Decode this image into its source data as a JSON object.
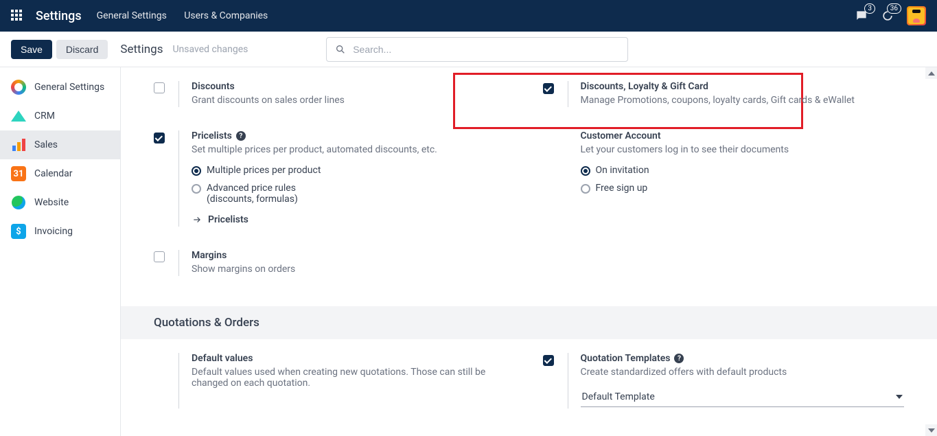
{
  "topnav": {
    "brand": "Settings",
    "menu": [
      "General Settings",
      "Users & Companies"
    ],
    "messages_badge": "3",
    "activities_badge": "36"
  },
  "actionbar": {
    "save": "Save",
    "discard": "Discard",
    "breadcrumb": "Settings",
    "unsaved": "Unsaved changes",
    "search_placeholder": "Search..."
  },
  "sidebar": {
    "items": [
      {
        "label": "General Settings"
      },
      {
        "label": "CRM"
      },
      {
        "label": "Sales"
      },
      {
        "label": "Calendar"
      },
      {
        "label": "Website"
      },
      {
        "label": "Invoicing"
      }
    ],
    "calendar_day": "31"
  },
  "settings": {
    "discounts": {
      "title": "Discounts",
      "desc": "Grant discounts on sales order lines",
      "checked": false
    },
    "loyalty": {
      "title": "Discounts, Loyalty & Gift Card",
      "desc": "Manage Promotions, coupons, loyalty cards, Gift cards & eWallet",
      "checked": true
    },
    "pricelists": {
      "title": "Pricelists",
      "desc": "Set multiple prices per product, automated discounts, etc.",
      "checked": true,
      "radios": {
        "multi": "Multiple prices per product",
        "adv_line1": "Advanced price rules",
        "adv_line2": "(discounts, formulas)",
        "selected": "multi"
      },
      "link": "Pricelists"
    },
    "customer_account": {
      "title": "Customer Account",
      "desc": "Let your customers log in to see their documents",
      "radios": {
        "invite": "On invitation",
        "free": "Free sign up",
        "selected": "invite"
      }
    },
    "margins": {
      "title": "Margins",
      "desc": "Show margins on orders",
      "checked": false
    },
    "section_quotations": "Quotations & Orders",
    "default_values": {
      "title": "Default values",
      "desc": "Default values used when creating new quotations. Those can still be changed on each quotation."
    },
    "quotation_templates": {
      "title": "Quotation Templates",
      "desc": "Create standardized offers with default products",
      "checked": true,
      "select_value": "Default Template"
    }
  },
  "icons": {
    "help": "?",
    "invoicing_glyph": "$"
  }
}
